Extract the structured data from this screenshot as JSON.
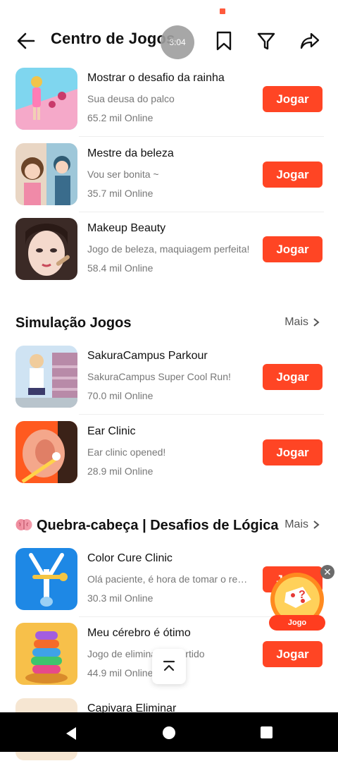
{
  "header": {
    "title": "Centro de Jogos",
    "time_bubble": "3:04"
  },
  "top_games": [
    {
      "title": "Mostrar o desafio da rainha",
      "desc": "Sua deusa do palco",
      "online": "65.2 mil Online",
      "button": "Jogar"
    },
    {
      "title": "Mestre da beleza",
      "desc": "Vou ser bonita ~",
      "online": "35.7 mil Online",
      "button": "Jogar"
    },
    {
      "title": "Makeup Beauty",
      "desc": "Jogo de beleza, maquiagem perfeita!",
      "online": "58.4 mil Online",
      "button": "Jogar"
    }
  ],
  "sections": [
    {
      "title": "Simulação Jogos",
      "more": "Mais",
      "games": [
        {
          "title": "SakuraCampus Parkour",
          "desc": "SakuraCampus Super Cool Run!",
          "online": "70.0 mil Online",
          "button": "Jogar"
        },
        {
          "title": "Ear Clinic",
          "desc": "Ear clinic opened!",
          "online": "28.9 mil Online",
          "button": "Jogar"
        }
      ]
    },
    {
      "title": "Quebra-cabeça | Desafios de Lógica",
      "more": "Mais",
      "games": [
        {
          "title": "Color Cure Clinic",
          "desc": "Olá paciente, é hora de tomar o rem...",
          "online": "30.3 mil Online",
          "button": "Jogar"
        },
        {
          "title": "Meu cérebro é ótimo",
          "desc": "Jogo de elimina... divertido",
          "online": "44.9 mil Online",
          "button": "Jogar"
        },
        {
          "title": "Capivara Eliminar",
          "desc": "",
          "online": "",
          "button": ""
        }
      ]
    }
  ],
  "floating": {
    "close": "✕",
    "game_label": "Jogo"
  },
  "colors": {
    "accent": "#ff4524",
    "text": "#111111",
    "muted": "#777777"
  }
}
